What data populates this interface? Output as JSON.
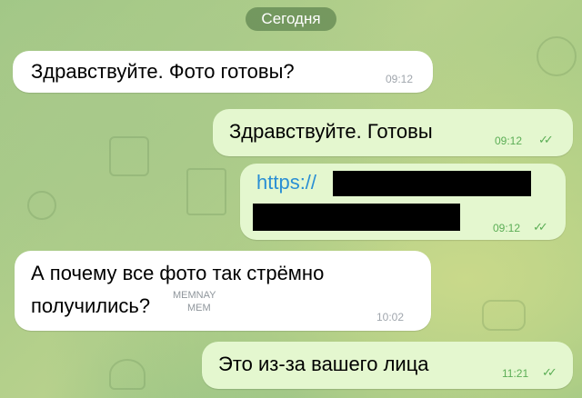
{
  "date_divider": "Сегодня",
  "messages": [
    {
      "text": "Здравствуйте. Фото готовы?",
      "time": "09:12"
    },
    {
      "text": "Здравствуйте. Готовы",
      "time": "09:12",
      "checks": "✓✓"
    },
    {
      "text_line1": "https://",
      "time": "09:12",
      "checks": "✓✓"
    },
    {
      "text_line1": "А почему все фото так стрёмно",
      "text_line2": "получились?",
      "time": "10:02"
    },
    {
      "text": "Это из-за вашего лица",
      "time": "11:21",
      "checks": "✓✓"
    }
  ],
  "watermark": {
    "line1": "MEMNAY",
    "line2": "MEM"
  }
}
